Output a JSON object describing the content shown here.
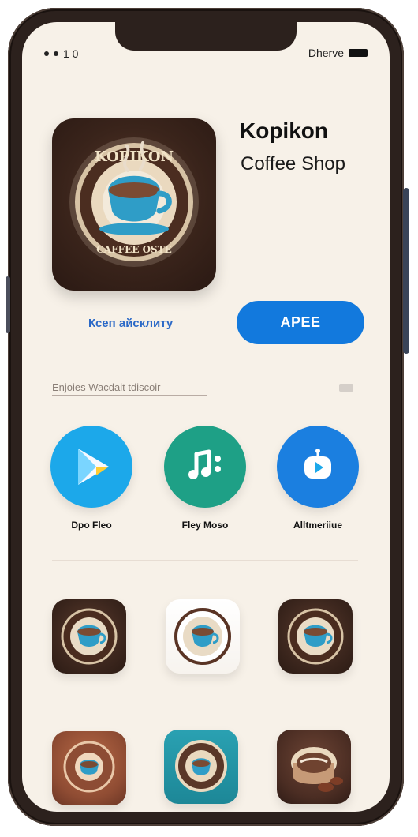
{
  "status_bar": {
    "left_text": "1 0",
    "right_text": "Dherve"
  },
  "app": {
    "title": "Kopikon",
    "subtitle": "Coffee Shop",
    "badge_top": "KOPIKON",
    "badge_bottom": "CAFFEE OSTE",
    "link_text": "Ксеп айсклиту",
    "get_label": "APEE"
  },
  "section": {
    "label": "Enjoies Wacdait tdiscoir"
  },
  "featured_apps": [
    {
      "label": "Dpo Fleo",
      "icon": "play-store-icon"
    },
    {
      "label": "Fley Moso",
      "icon": "music-app-icon"
    },
    {
      "label": "Alltmeriiue",
      "icon": "media-app-icon"
    }
  ],
  "tiles": [
    {
      "style": "dark",
      "icon": "coffee-badge-icon"
    },
    {
      "style": "light",
      "icon": "coffee-badge-icon"
    },
    {
      "style": "dark",
      "icon": "coffee-badge-icon"
    },
    {
      "style": "amber",
      "icon": "coffee-badge-icon"
    },
    {
      "style": "teal",
      "icon": "coffee-badge-icon"
    },
    {
      "style": "brown",
      "icon": "coffee-badge-icon"
    }
  ],
  "colors": {
    "screen_bg": "#f7f1e8",
    "phone_frame": "#2c211d",
    "get_button": "#1279dd",
    "play_circle": "#1ca8ea",
    "music_circle": "#1ea086",
    "media_circle": "#1b7fe0",
    "coffee_cup": "#2f9dc7",
    "coffee_brown": "#3a241b"
  }
}
